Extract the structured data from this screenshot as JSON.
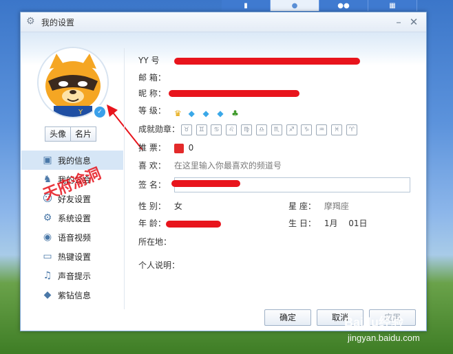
{
  "window": {
    "title": "我的设置"
  },
  "sidebar": {
    "photo_buttons": [
      "头像",
      "名片"
    ],
    "items": [
      {
        "label": "我的信息",
        "icon": "id-card-icon"
      },
      {
        "label": "我的公会",
        "icon": "guild-icon"
      },
      {
        "label": "好友设置",
        "icon": "friends-icon"
      },
      {
        "label": "系统设置",
        "icon": "gear-icon"
      },
      {
        "label": "语音视频",
        "icon": "webcam-icon"
      },
      {
        "label": "热键设置",
        "icon": "keyboard-icon"
      },
      {
        "label": "声音提示",
        "icon": "music-note-icon"
      },
      {
        "label": "紫钻信息",
        "icon": "diamond-icon"
      }
    ]
  },
  "profile": {
    "yy_label": "YY 号",
    "email_label": "邮 箱：",
    "nickname_label": "昵 称：",
    "level_label": "等 级：",
    "medals_label": "成就勋章：",
    "votes_label": "推 票：",
    "votes_value": "0",
    "likes_label": "喜 欢：",
    "likes_hint": "在这里输入你最喜欢的频道号",
    "signature_label": "签 名：",
    "gender_label": "性 别：",
    "gender_value": "女",
    "constellation_label": "星 座：",
    "constellation_value": "摩羯座",
    "age_label": "年 龄：",
    "birthday_label": "生 日：",
    "birthday_value": "1月　 01日",
    "location_label": "所在地：",
    "intro_label": "个人说明："
  },
  "footer": {
    "ok_label": "确定",
    "cancel_label": "取消",
    "apply_label": "应用"
  },
  "watermarks": {
    "cn": "天府渝洞",
    "baidu": "Baidu经验",
    "url": "jingyan.baidu.com"
  }
}
